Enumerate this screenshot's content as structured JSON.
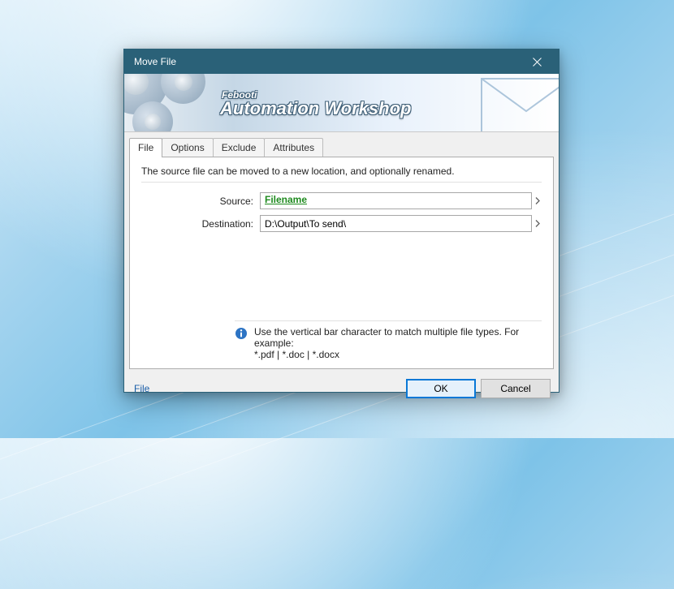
{
  "window": {
    "title": "Move File"
  },
  "banner": {
    "brand_small": "Febooti",
    "brand_big": "Automation Workshop"
  },
  "tabs": [
    {
      "label": "File",
      "active": true
    },
    {
      "label": "Options",
      "active": false
    },
    {
      "label": "Exclude",
      "active": false
    },
    {
      "label": "Attributes",
      "active": false
    }
  ],
  "panel": {
    "description": "The source file can be moved to a new location, and optionally renamed.",
    "source_label": "Source:",
    "source_value": "Filename",
    "destination_label": "Destination:",
    "destination_value": "D:\\Output\\To send\\",
    "hint_line1": "Use the vertical bar character to match multiple file types. For example:",
    "hint_line2": "*.pdf | *.doc | *.docx"
  },
  "footer": {
    "link_label": "File",
    "ok_label": "OK",
    "cancel_label": "Cancel"
  }
}
